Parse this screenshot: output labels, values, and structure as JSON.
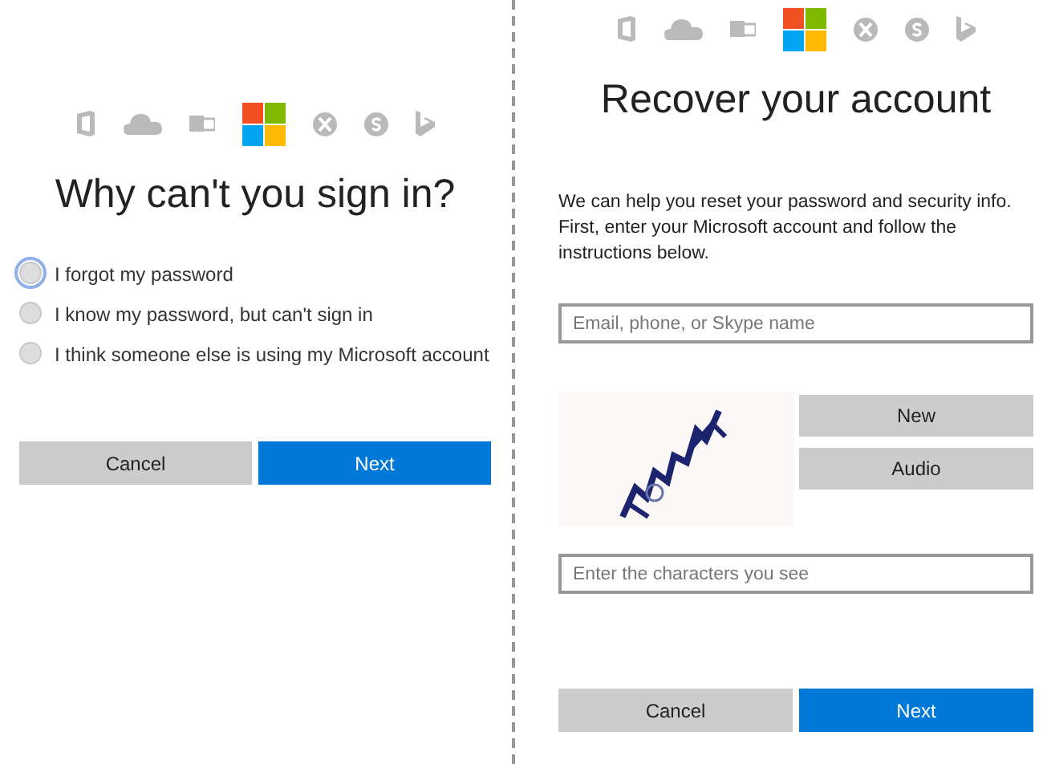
{
  "sign_in_help": {
    "title": "Why can't you sign in?",
    "options": [
      {
        "label": "I forgot my password",
        "selected": false,
        "focused": true
      },
      {
        "label": "I know my password, but can't sign in",
        "selected": false,
        "focused": false
      },
      {
        "label": "I think someone else is using my Microsoft account",
        "selected": false,
        "focused": false
      }
    ],
    "buttons": [
      {
        "label": "Cancel",
        "kind": "secondary"
      },
      {
        "label": "Next",
        "kind": "primary"
      }
    ]
  },
  "recover": {
    "title": "Recover your account",
    "intro": "We can help you reset your password and security info. First, enter your Microsoft account and follow the instructions below.",
    "account_field": {
      "placeholder": "Email, phone, or Skype name"
    },
    "captcha": {
      "kind": "picture",
      "buttons": [
        "New",
        "Audio"
      ]
    },
    "characters_field": {
      "placeholder": "Enter the characters you see"
    },
    "buttons": [
      {
        "label": "Cancel",
        "kind": "secondary"
      },
      {
        "label": "Next",
        "kind": "primary"
      }
    ]
  }
}
